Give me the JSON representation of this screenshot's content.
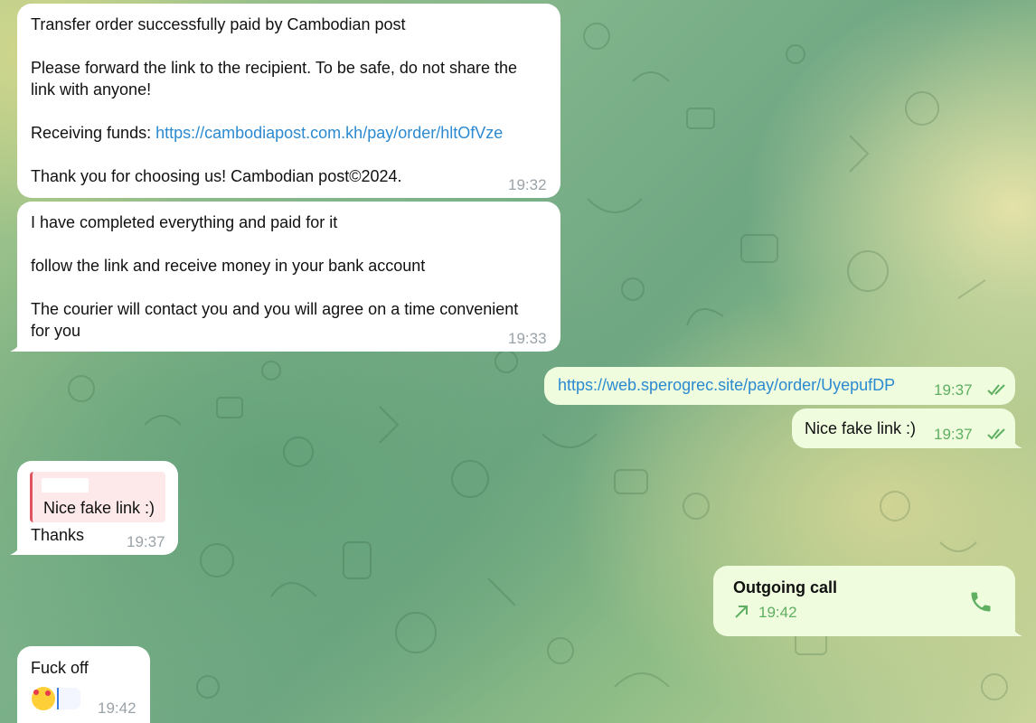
{
  "messages": {
    "m1": {
      "line1": "Transfer order successfully paid by Cambodian post",
      "line2": "Please forward the link to the recipient. To be safe, do not share the",
      "line3": "link with anyone!",
      "funds_label": "Receiving funds: ",
      "funds_link": "https://cambodiapost.com.kh/pay/order/hltOfVze",
      "line5": "Thank you for choosing us! Cambodian post©2024.",
      "time": "19:32"
    },
    "m2": {
      "line1": "I have completed everything and paid for it",
      "line2": "follow the link and receive money in your bank account",
      "line3": "The courier will contact you and you will agree on a time convenient",
      "line4": "for you",
      "time": "19:33"
    },
    "m3": {
      "link": "https://web.sperogrec.site/pay/order/UyepufDP",
      "time": "19:37"
    },
    "m4": {
      "text": "Nice fake link :)",
      "time": "19:37"
    },
    "m5": {
      "quote_text": "Nice fake link :)",
      "text": "Thanks",
      "time": "19:37"
    },
    "m6": {
      "title": "Outgoing call",
      "time": "19:42",
      "icon": "phone-icon"
    },
    "m7": {
      "text": "Fuck off",
      "emoji": "smiling-face-with-hearts-icon",
      "time": "19:42"
    }
  },
  "colors": {
    "incoming_bubble": "#ffffff",
    "outgoing_bubble": "#effdde",
    "link": "#2b8ad0",
    "outgoing_accent": "#5faf62",
    "quote_bar": "#e0545f"
  }
}
